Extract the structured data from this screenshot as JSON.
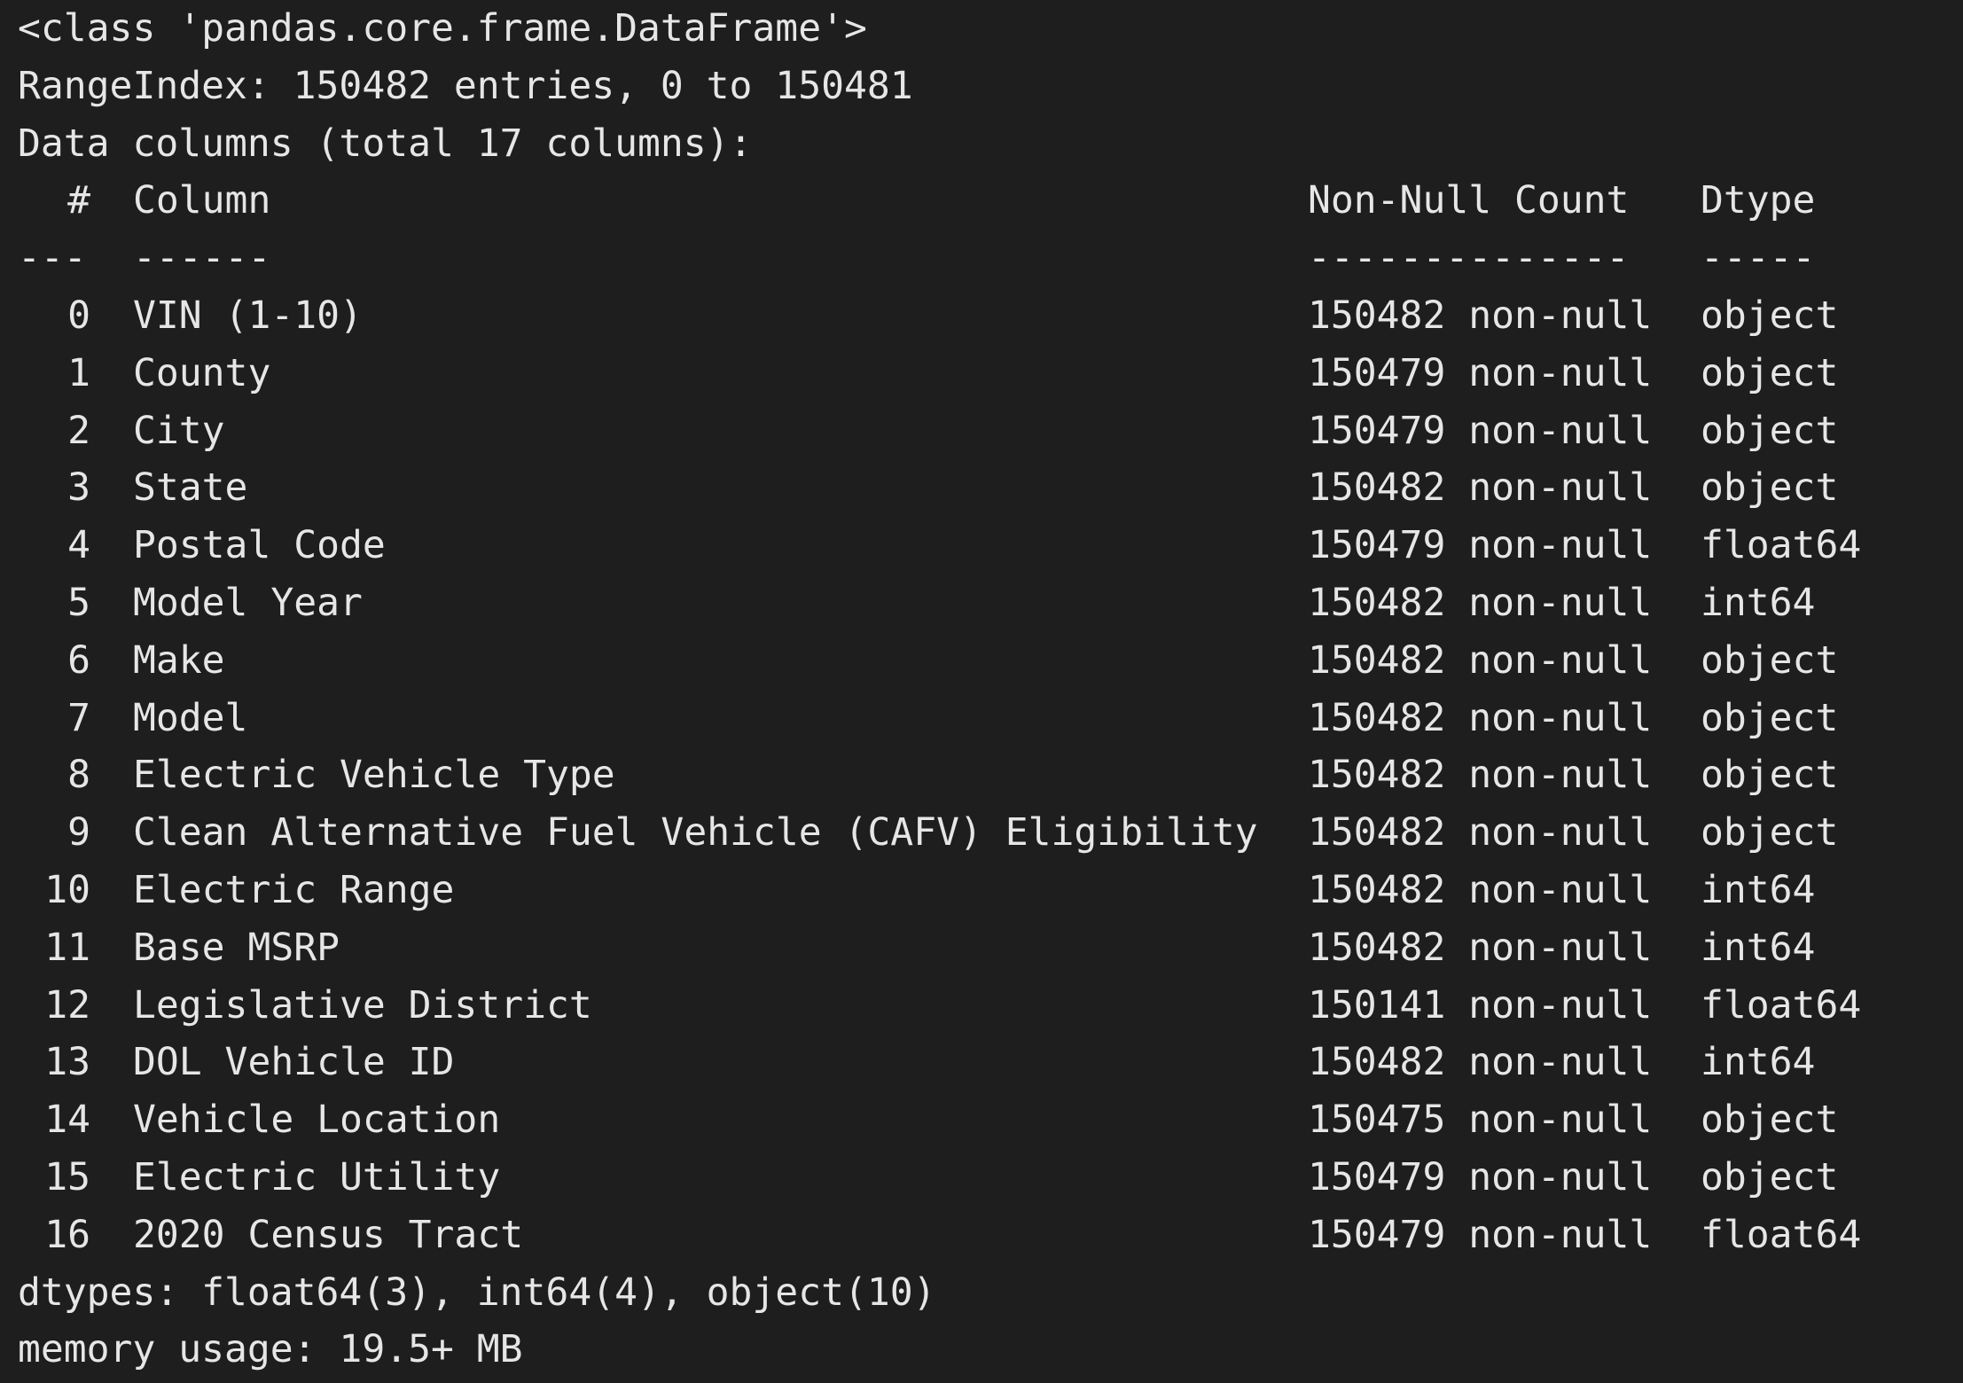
{
  "header": {
    "class_line": "<class 'pandas.core.frame.DataFrame'>",
    "range_index": "RangeIndex: 150482 entries, 0 to 150481",
    "data_columns": "Data columns (total 17 columns):"
  },
  "table": {
    "headers": {
      "idx": "#",
      "column": "Column",
      "count": "Non-Null Count",
      "dtype": "Dtype"
    },
    "separators": {
      "idx": "---",
      "column": "------",
      "count": "--------------",
      "dtype": "-----"
    },
    "rows": [
      {
        "idx": "0",
        "column": "VIN (1-10)",
        "count": "150482 non-null",
        "dtype": "object"
      },
      {
        "idx": "1",
        "column": "County",
        "count": "150479 non-null",
        "dtype": "object"
      },
      {
        "idx": "2",
        "column": "City",
        "count": "150479 non-null",
        "dtype": "object"
      },
      {
        "idx": "3",
        "column": "State",
        "count": "150482 non-null",
        "dtype": "object"
      },
      {
        "idx": "4",
        "column": "Postal Code",
        "count": "150479 non-null",
        "dtype": "float64"
      },
      {
        "idx": "5",
        "column": "Model Year",
        "count": "150482 non-null",
        "dtype": "int64"
      },
      {
        "idx": "6",
        "column": "Make",
        "count": "150482 non-null",
        "dtype": "object"
      },
      {
        "idx": "7",
        "column": "Model",
        "count": "150482 non-null",
        "dtype": "object"
      },
      {
        "idx": "8",
        "column": "Electric Vehicle Type",
        "count": "150482 non-null",
        "dtype": "object"
      },
      {
        "idx": "9",
        "column": "Clean Alternative Fuel Vehicle (CAFV) Eligibility",
        "count": "150482 non-null",
        "dtype": "object"
      },
      {
        "idx": "10",
        "column": "Electric Range",
        "count": "150482 non-null",
        "dtype": "int64"
      },
      {
        "idx": "11",
        "column": "Base MSRP",
        "count": "150482 non-null",
        "dtype": "int64"
      },
      {
        "idx": "12",
        "column": "Legislative District",
        "count": "150141 non-null",
        "dtype": "float64"
      },
      {
        "idx": "13",
        "column": "DOL Vehicle ID",
        "count": "150482 non-null",
        "dtype": "int64"
      },
      {
        "idx": "14",
        "column": "Vehicle Location",
        "count": "150475 non-null",
        "dtype": "object"
      },
      {
        "idx": "15",
        "column": "Electric Utility",
        "count": "150479 non-null",
        "dtype": "object"
      },
      {
        "idx": "16",
        "column": "2020 Census Tract",
        "count": "150479 non-null",
        "dtype": "float64"
      }
    ]
  },
  "footer": {
    "dtypes": "dtypes: float64(3), int64(4), object(10)",
    "memory": "memory usage: 19.5+ MB"
  },
  "colors": {
    "background": "#1e1e1e",
    "text": "#e6e6e6"
  }
}
